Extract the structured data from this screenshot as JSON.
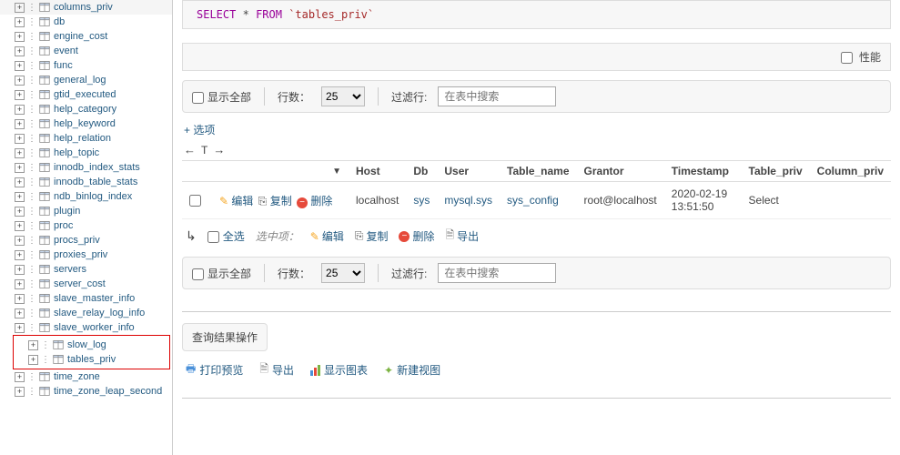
{
  "sidebar": {
    "items": [
      {
        "label": "columns_priv"
      },
      {
        "label": "db"
      },
      {
        "label": "engine_cost"
      },
      {
        "label": "event"
      },
      {
        "label": "func"
      },
      {
        "label": "general_log"
      },
      {
        "label": "gtid_executed"
      },
      {
        "label": "help_category"
      },
      {
        "label": "help_keyword"
      },
      {
        "label": "help_relation"
      },
      {
        "label": "help_topic"
      },
      {
        "label": "innodb_index_stats"
      },
      {
        "label": "innodb_table_stats"
      },
      {
        "label": "ndb_binlog_index"
      },
      {
        "label": "plugin"
      },
      {
        "label": "proc"
      },
      {
        "label": "procs_priv"
      },
      {
        "label": "proxies_priv"
      },
      {
        "label": "servers"
      },
      {
        "label": "server_cost"
      },
      {
        "label": "slave_master_info"
      },
      {
        "label": "slave_relay_log_info"
      },
      {
        "label": "slave_worker_info"
      },
      {
        "label": "slow_log"
      },
      {
        "label": "tables_priv"
      },
      {
        "label": "time_zone"
      },
      {
        "label": "time_zone_leap_second"
      }
    ],
    "highlighted_start": 23,
    "highlighted_end": 24
  },
  "sql": {
    "select": "SELECT",
    "star": "*",
    "from": "FROM",
    "table": "`tables_priv`"
  },
  "perf_opt": "性能",
  "toolbar": {
    "show_all": "显示全部",
    "rows_label": "行数：",
    "rows_value": "25",
    "filter_label": "过滤行:",
    "filter_placeholder": "在表中搜索"
  },
  "options_link": "+ 选项",
  "columns": [
    "Host",
    "Db",
    "User",
    "Table_name",
    "Grantor",
    "Timestamp",
    "Table_priv",
    "Column_priv"
  ],
  "actions": {
    "edit": "编辑",
    "copy": "复制",
    "delete": "删除"
  },
  "rows": [
    {
      "host": "localhost",
      "db": "sys",
      "user": "mysql.sys",
      "table_name": "sys_config",
      "grantor": "root@localhost",
      "timestamp": "2020-02-19 13:51:50",
      "table_priv": "Select",
      "column_priv": ""
    }
  ],
  "bulk": {
    "select_all": "全选",
    "with_selected": "选中项：",
    "edit": "编辑",
    "copy": "复制",
    "delete": "删除",
    "export": "导出"
  },
  "result_ops": {
    "title": "查询结果操作",
    "print": "打印预览",
    "export": "导出",
    "chart": "显示图表",
    "newview": "新建视图"
  }
}
